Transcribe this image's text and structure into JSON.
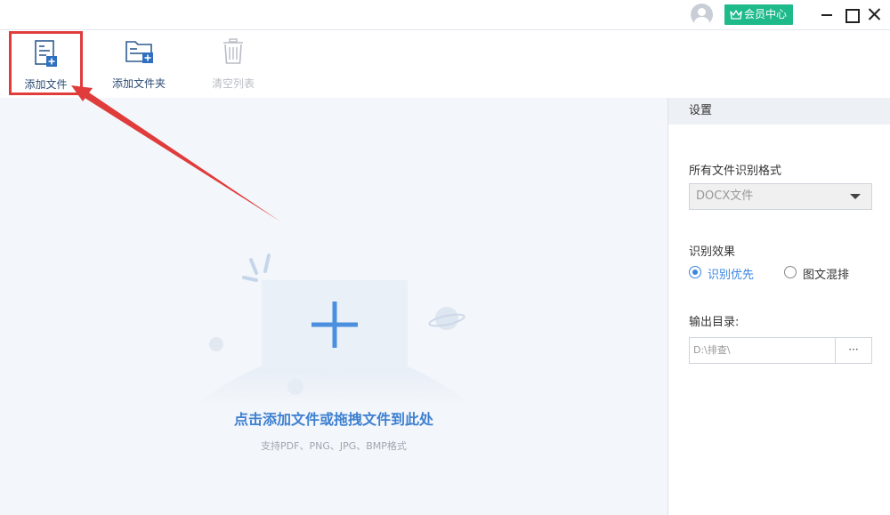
{
  "titlebar": {
    "vip_label": "会员中心"
  },
  "toolbar": {
    "add_file": "添加文件",
    "add_folder": "添加文件夹",
    "clear_list": "清空列表"
  },
  "droparea": {
    "title": "点击添加文件或拖拽文件到此处",
    "subtitle": "支持PDF、PNG、JPG、BMP格式"
  },
  "settings": {
    "header": "设置",
    "format_label": "所有文件识别格式",
    "format_value": "DOCX文件",
    "effect_label": "识别效果",
    "effect_options": [
      "识别优先",
      "图文混排"
    ],
    "effect_selected": "识别优先",
    "output_label": "输出目录:",
    "output_value": "D:\\排查\\",
    "browse_label": "···"
  },
  "colors": {
    "accent": "#3e80d0",
    "vip_green": "#1fba8a",
    "highlight_red": "#e03c3c",
    "drop_bg": "#f3f6fa"
  }
}
